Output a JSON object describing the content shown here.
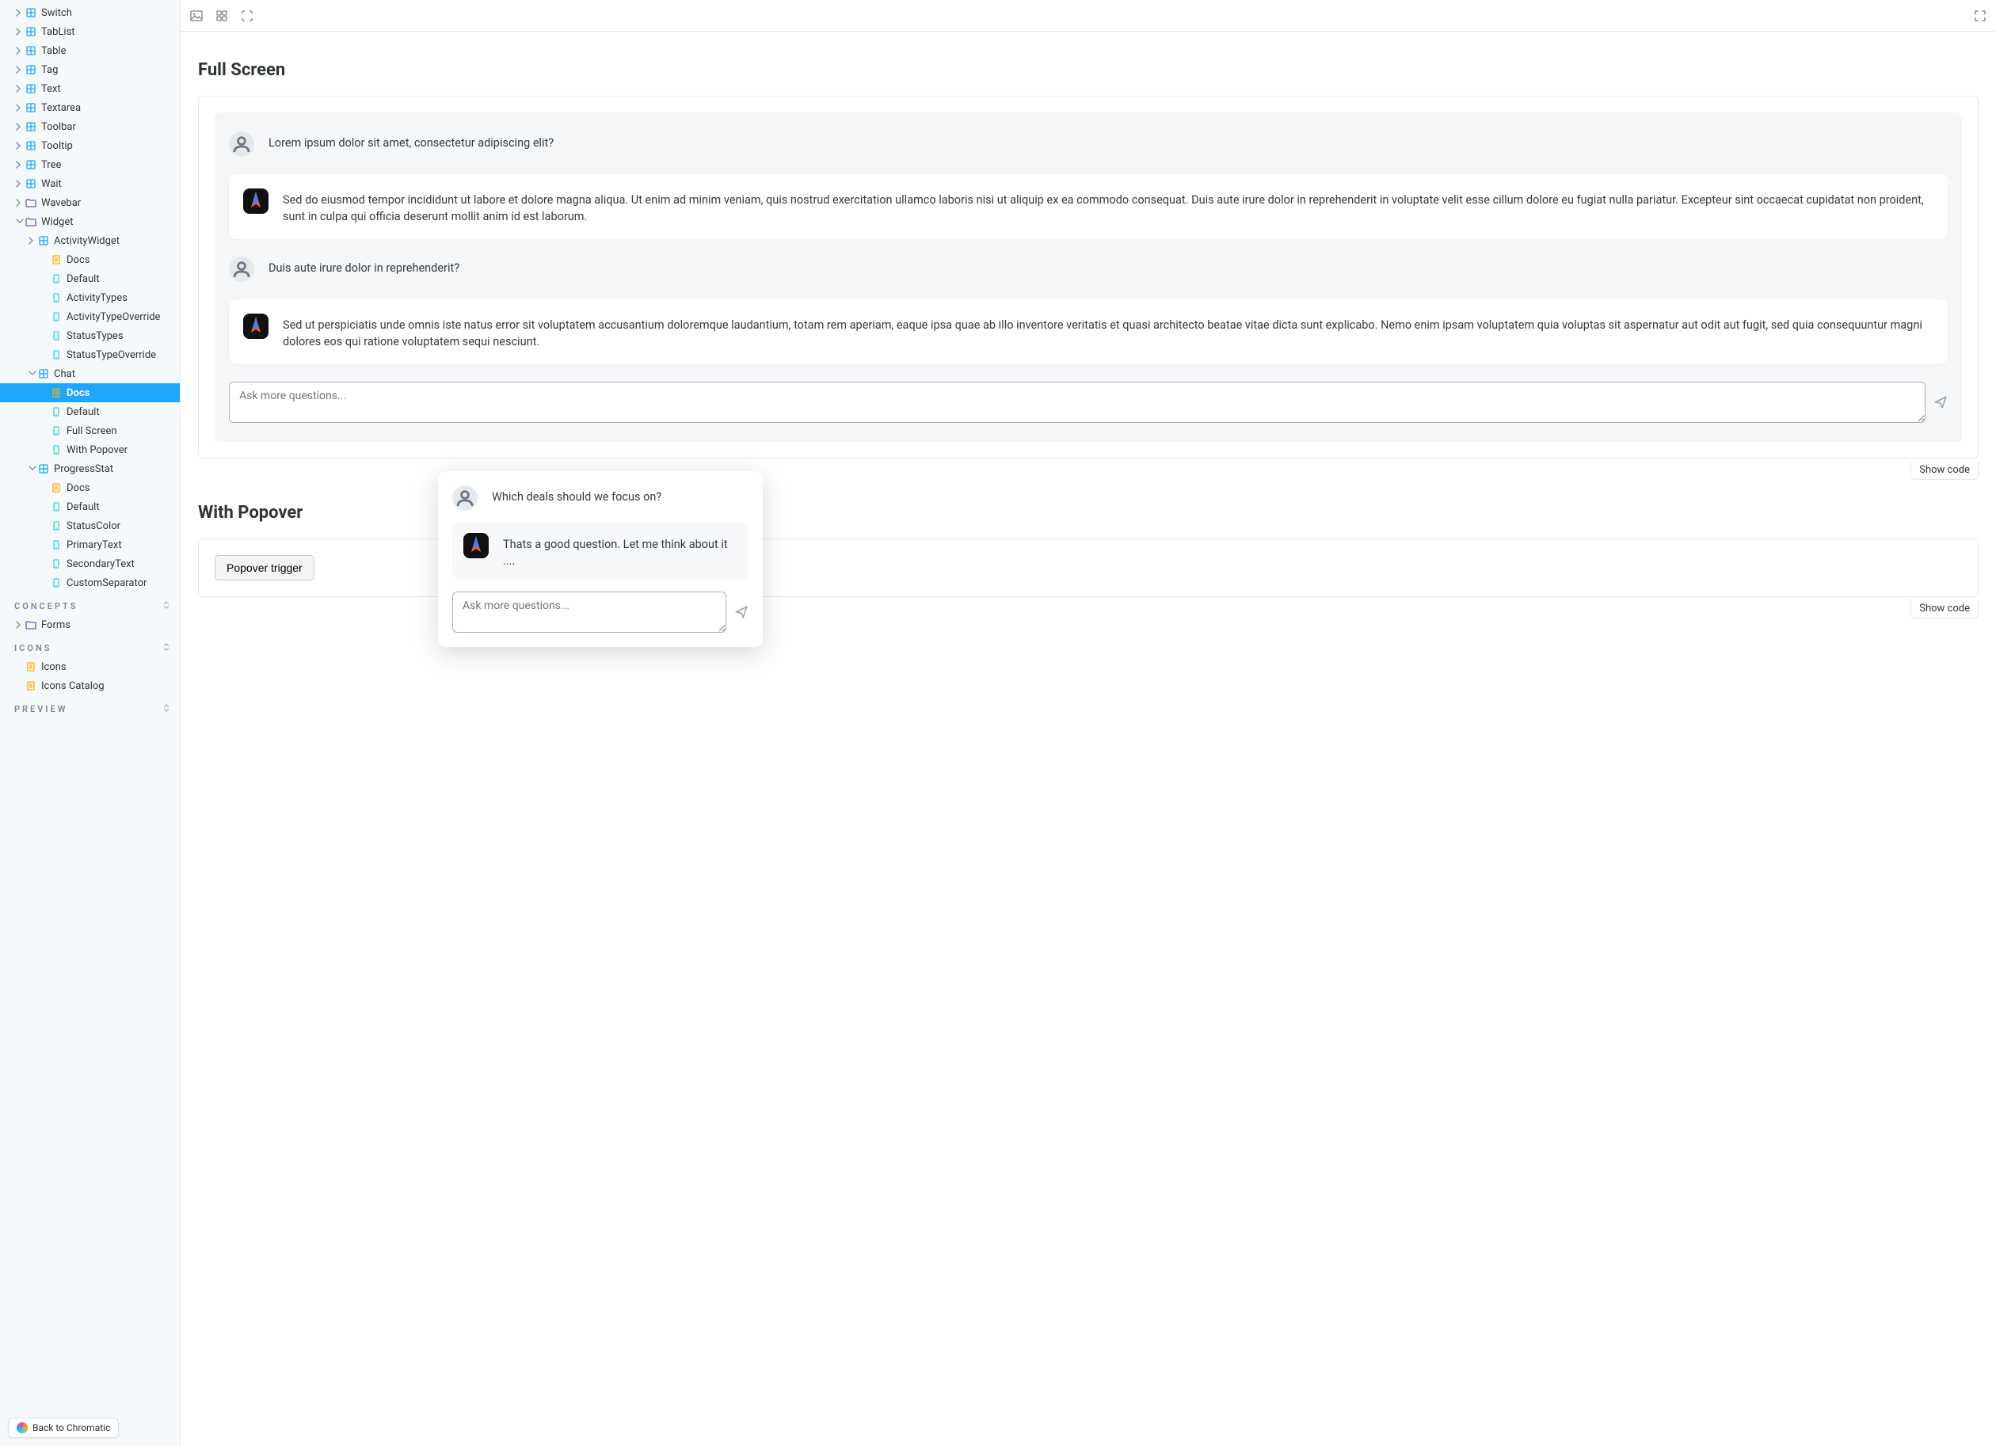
{
  "sidebar": {
    "tree": [
      {
        "label": "Switch",
        "kind": "component",
        "indent": 1,
        "caret": "right"
      },
      {
        "label": "TabList",
        "kind": "component",
        "indent": 1,
        "caret": "right"
      },
      {
        "label": "Table",
        "kind": "component",
        "indent": 1,
        "caret": "right"
      },
      {
        "label": "Tag",
        "kind": "component",
        "indent": 1,
        "caret": "right"
      },
      {
        "label": "Text",
        "kind": "component",
        "indent": 1,
        "caret": "right"
      },
      {
        "label": "Textarea",
        "kind": "component",
        "indent": 1,
        "caret": "right"
      },
      {
        "label": "Toolbar",
        "kind": "component",
        "indent": 1,
        "caret": "right"
      },
      {
        "label": "Tooltip",
        "kind": "component",
        "indent": 1,
        "caret": "right"
      },
      {
        "label": "Tree",
        "kind": "component",
        "indent": 1,
        "caret": "right"
      },
      {
        "label": "Wait",
        "kind": "component",
        "indent": 1,
        "caret": "right"
      },
      {
        "label": "Wavebar",
        "kind": "folder",
        "indent": 1,
        "caret": "right"
      },
      {
        "label": "Widget",
        "kind": "folder",
        "indent": 1,
        "caret": "down"
      },
      {
        "label": "ActivityWidget",
        "kind": "component",
        "indent": 2,
        "caret": "right"
      },
      {
        "label": "Docs",
        "kind": "doc",
        "indent": 3,
        "caret": "none"
      },
      {
        "label": "Default",
        "kind": "story",
        "indent": 3,
        "caret": "none"
      },
      {
        "label": "ActivityTypes",
        "kind": "story",
        "indent": 3,
        "caret": "none"
      },
      {
        "label": "ActivityTypeOverride",
        "kind": "story",
        "indent": 3,
        "caret": "none"
      },
      {
        "label": "StatusTypes",
        "kind": "story",
        "indent": 3,
        "caret": "none"
      },
      {
        "label": "StatusTypeOverride",
        "kind": "story",
        "indent": 3,
        "caret": "none"
      },
      {
        "label": "Chat",
        "kind": "component",
        "indent": 2,
        "caret": "down"
      },
      {
        "label": "Docs",
        "kind": "doc",
        "indent": 3,
        "caret": "none",
        "selected": true
      },
      {
        "label": "Default",
        "kind": "story",
        "indent": 3,
        "caret": "none"
      },
      {
        "label": "Full Screen",
        "kind": "story",
        "indent": 3,
        "caret": "none"
      },
      {
        "label": "With Popover",
        "kind": "story",
        "indent": 3,
        "caret": "none"
      },
      {
        "label": "ProgressStat",
        "kind": "component",
        "indent": 2,
        "caret": "down"
      },
      {
        "label": "Docs",
        "kind": "doc",
        "indent": 3,
        "caret": "none"
      },
      {
        "label": "Default",
        "kind": "story",
        "indent": 3,
        "caret": "none"
      },
      {
        "label": "StatusColor",
        "kind": "story",
        "indent": 3,
        "caret": "none"
      },
      {
        "label": "PrimaryText",
        "kind": "story",
        "indent": 3,
        "caret": "none"
      },
      {
        "label": "SecondaryText",
        "kind": "story",
        "indent": 3,
        "caret": "none"
      },
      {
        "label": "CustomSeparator",
        "kind": "story",
        "indent": 3,
        "caret": "none"
      }
    ],
    "sections": [
      {
        "title": "CONCEPTS",
        "items": [
          {
            "label": "Forms",
            "kind": "folder",
            "indent": 1,
            "caret": "right"
          }
        ]
      },
      {
        "title": "ICONS",
        "items": [
          {
            "label": "Icons",
            "kind": "doc",
            "indent": 1,
            "caret": "none"
          },
          {
            "label": "Icons Catalog",
            "kind": "doc",
            "indent": 1,
            "caret": "none"
          }
        ]
      },
      {
        "title": "PREVIEW",
        "items": []
      }
    ],
    "back_label": "Back to Chromatic"
  },
  "main": {
    "story1": {
      "title": "Full Screen",
      "messages": [
        {
          "role": "user",
          "text": "Lorem ipsum dolor sit amet, consectetur adipiscing elit?"
        },
        {
          "role": "bot",
          "text": "Sed do eiusmod tempor incididunt ut labore et dolore magna aliqua. Ut enim ad minim veniam, quis nostrud exercitation ullamco laboris nisi ut aliquip ex ea commodo consequat. Duis aute irure dolor in reprehenderit in voluptate velit esse cillum dolore eu fugiat nulla pariatur. Excepteur sint occaecat cupidatat non proident, sunt in culpa qui officia deserunt mollit anim id est laborum."
        },
        {
          "role": "user",
          "text": "Duis aute irure dolor in reprehenderit?"
        },
        {
          "role": "bot",
          "text": "Sed ut perspiciatis unde omnis iste natus error sit voluptatem accusantium doloremque laudantium, totam rem aperiam, eaque ipsa quae ab illo inventore veritatis et quasi architecto beatae vitae dicta sunt explicabo. Nemo enim ipsam voluptatem quia voluptas sit aspernatur aut odit aut fugit, sed quia consequuntur magni dolores eos qui ratione voluptatem sequi nesciunt."
        }
      ],
      "input_placeholder": "Ask more questions...",
      "show_code": "Show code"
    },
    "story2": {
      "title": "With Popover",
      "trigger_label": "Popover trigger",
      "show_code": "Show code"
    },
    "popover": {
      "messages": [
        {
          "role": "user",
          "text": "Which deals should we focus on?"
        },
        {
          "role": "bot",
          "text": "Thats a good question. Let me think about it ...."
        }
      ],
      "input_placeholder": "Ask more questions..."
    }
  }
}
